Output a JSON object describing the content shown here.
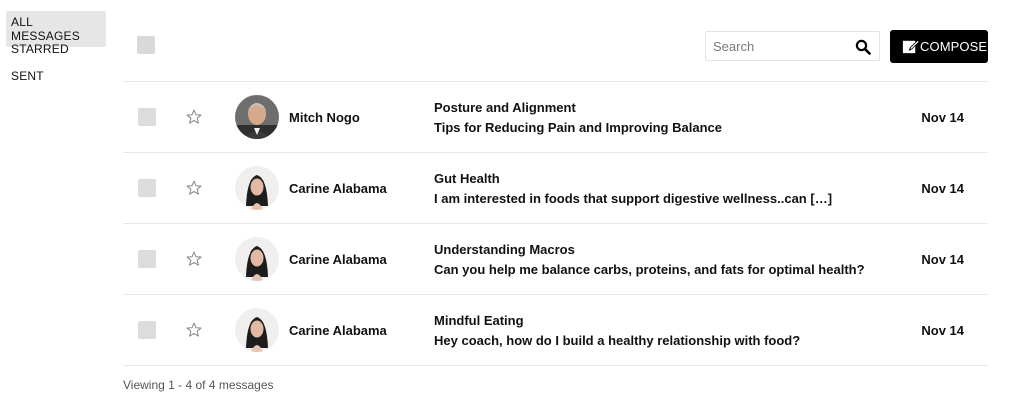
{
  "sidebar": {
    "items": [
      {
        "label": "ALL MESSAGES",
        "active": true
      },
      {
        "label": "STARRED",
        "active": false
      },
      {
        "label": "SENT",
        "active": false
      }
    ]
  },
  "toolbar": {
    "search_placeholder": "Search",
    "search_icon": "search-icon",
    "compose_label": "COMPOSE",
    "compose_icon": "compose-icon"
  },
  "messages": [
    {
      "sender": "Mitch Nogo",
      "subject": "Posture and Alignment",
      "preview": "Tips for Reducing Pain and Improving Balance",
      "date": "Nov 14",
      "avatar": "male-avatar"
    },
    {
      "sender": "Carine Alabama",
      "subject": "Gut Health",
      "preview": "I am interested in foods that support digestive wellness..can […]",
      "date": "Nov 14",
      "avatar": "female-avatar"
    },
    {
      "sender": "Carine Alabama",
      "subject": "Understanding Macros",
      "preview": "Can you help me balance carbs, proteins, and fats for optimal health?",
      "date": "Nov 14",
      "avatar": "female-avatar"
    },
    {
      "sender": "Carine Alabama",
      "subject": "Mindful Eating",
      "preview": "Hey coach, how do I build a healthy relationship with food?",
      "date": "Nov 14",
      "avatar": "female-avatar"
    }
  ],
  "footer": {
    "status": "Viewing 1 - 4 of 4 messages"
  },
  "colors": {
    "compose_bg": "#000000",
    "active_nav_bg": "#e6e6e6",
    "checkbox": "#d9d9d9"
  }
}
